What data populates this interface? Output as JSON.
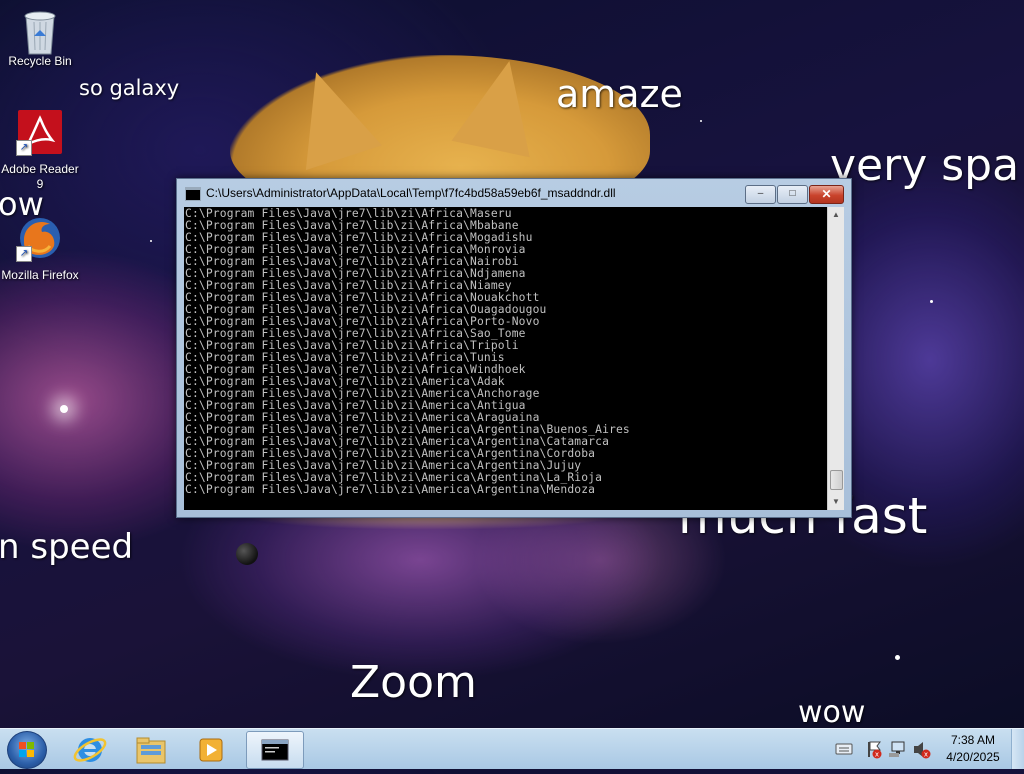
{
  "desktop": {
    "icons": [
      {
        "label": "Recycle Bin",
        "icon": "recycle-bin-icon"
      },
      {
        "label": "Adobe Reader 9",
        "icon": "adobe-reader-icon"
      },
      {
        "label": "Mozilla Firefox",
        "icon": "firefox-icon"
      }
    ],
    "wallpaper_text": {
      "so_galaxy": "so galaxy",
      "amaze": "amaze",
      "very_spa": "very spa",
      "wow_left": "ow",
      "such_speed": "n speed",
      "much_fast": "much fast",
      "zoom": "Zoom",
      "wow_bottom": "wow"
    }
  },
  "console_window": {
    "title": "C:\\Users\\Administrator\\AppData\\Local\\Temp\\f7fc4bd58a59eb6f_msaddndr.dll",
    "buttons": {
      "minimize": "–",
      "maximize": "□",
      "close": "✕"
    },
    "lines": [
      "C:\\Program Files\\Java\\jre7\\lib\\zi\\Africa\\Maseru",
      "C:\\Program Files\\Java\\jre7\\lib\\zi\\Africa\\Mbabane",
      "C:\\Program Files\\Java\\jre7\\lib\\zi\\Africa\\Mogadishu",
      "C:\\Program Files\\Java\\jre7\\lib\\zi\\Africa\\Monrovia",
      "C:\\Program Files\\Java\\jre7\\lib\\zi\\Africa\\Nairobi",
      "C:\\Program Files\\Java\\jre7\\lib\\zi\\Africa\\Ndjamena",
      "C:\\Program Files\\Java\\jre7\\lib\\zi\\Africa\\Niamey",
      "C:\\Program Files\\Java\\jre7\\lib\\zi\\Africa\\Nouakchott",
      "C:\\Program Files\\Java\\jre7\\lib\\zi\\Africa\\Ouagadougou",
      "C:\\Program Files\\Java\\jre7\\lib\\zi\\Africa\\Porto-Novo",
      "C:\\Program Files\\Java\\jre7\\lib\\zi\\Africa\\Sao_Tome",
      "C:\\Program Files\\Java\\jre7\\lib\\zi\\Africa\\Tripoli",
      "C:\\Program Files\\Java\\jre7\\lib\\zi\\Africa\\Tunis",
      "C:\\Program Files\\Java\\jre7\\lib\\zi\\Africa\\Windhoek",
      "C:\\Program Files\\Java\\jre7\\lib\\zi\\America\\Adak",
      "C:\\Program Files\\Java\\jre7\\lib\\zi\\America\\Anchorage",
      "C:\\Program Files\\Java\\jre7\\lib\\zi\\America\\Antigua",
      "C:\\Program Files\\Java\\jre7\\lib\\zi\\America\\Araguaina",
      "C:\\Program Files\\Java\\jre7\\lib\\zi\\America\\Argentina\\Buenos_Aires",
      "C:\\Program Files\\Java\\jre7\\lib\\zi\\America\\Argentina\\Catamarca",
      "C:\\Program Files\\Java\\jre7\\lib\\zi\\America\\Argentina\\Cordoba",
      "C:\\Program Files\\Java\\jre7\\lib\\zi\\America\\Argentina\\Jujuy",
      "C:\\Program Files\\Java\\jre7\\lib\\zi\\America\\Argentina\\La_Rioja",
      "C:\\Program Files\\Java\\jre7\\lib\\zi\\America\\Argentina\\Mendoza"
    ],
    "colors": {
      "background": "#000000",
      "text": "#c0c0c0",
      "close_button": "#c9432c"
    }
  },
  "taskbar": {
    "items": [
      {
        "icon": "internet-explorer-icon"
      },
      {
        "icon": "file-explorer-icon"
      },
      {
        "icon": "media-player-icon"
      },
      {
        "icon": "console-window-icon",
        "active": true
      }
    ],
    "tray_icons": [
      "keyboard-icon",
      "action-center-flag-icon",
      "network-icon",
      "volume-muted-icon"
    ],
    "clock": {
      "time": "7:38 AM",
      "date": "4/20/2025"
    }
  }
}
